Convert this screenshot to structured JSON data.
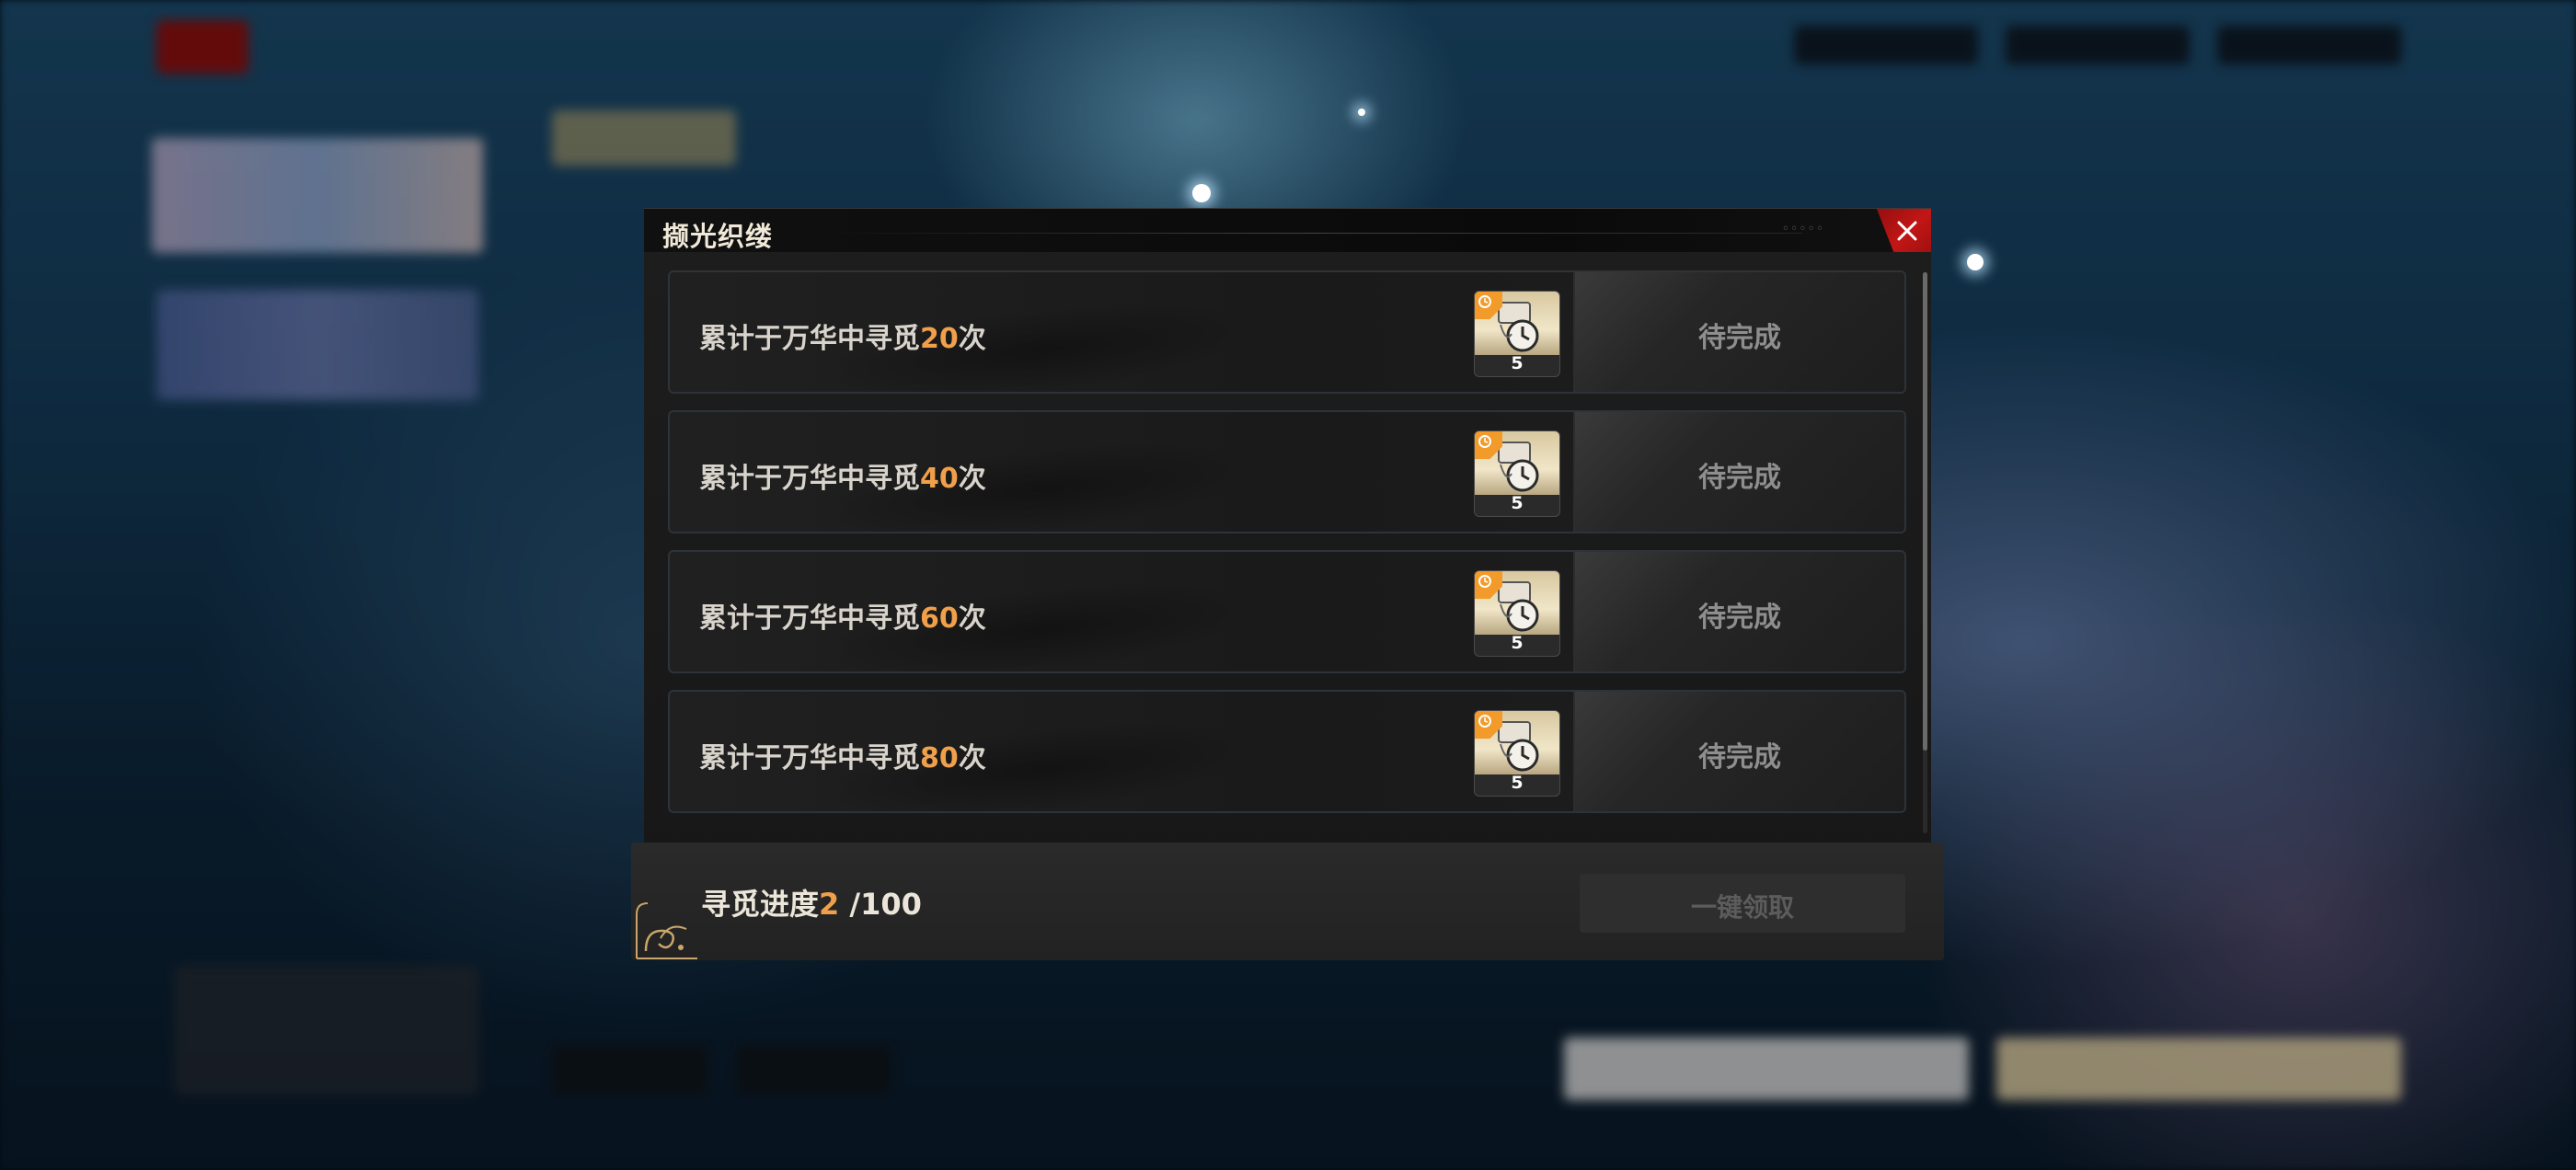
{
  "dialog": {
    "title": "撷光织缕",
    "close_icon": "close-icon"
  },
  "tasks": [
    {
      "prefix": "累计于万华中寻觅",
      "count": "20",
      "suffix": "次",
      "reward_count": "5",
      "status": "待完成"
    },
    {
      "prefix": "累计于万华中寻觅",
      "count": "40",
      "suffix": "次",
      "reward_count": "5",
      "status": "待完成"
    },
    {
      "prefix": "累计于万华中寻觅",
      "count": "60",
      "suffix": "次",
      "reward_count": "5",
      "status": "待完成"
    },
    {
      "prefix": "累计于万华中寻觅",
      "count": "80",
      "suffix": "次",
      "reward_count": "5",
      "status": "待完成"
    }
  ],
  "footer": {
    "progress_label": "寻觅进度",
    "progress_current": "2",
    "progress_total": " /100",
    "claim_all_label": "一键领取"
  },
  "colors": {
    "accent_orange": "#f0a04a",
    "close_red": "#c21616",
    "badge_orange": "#f29b2b"
  },
  "icons": {
    "reward_item": "pocket-watch-icon",
    "reward_badge": "clock-badge-icon",
    "footer_ornament": "scroll-ornament-icon"
  }
}
